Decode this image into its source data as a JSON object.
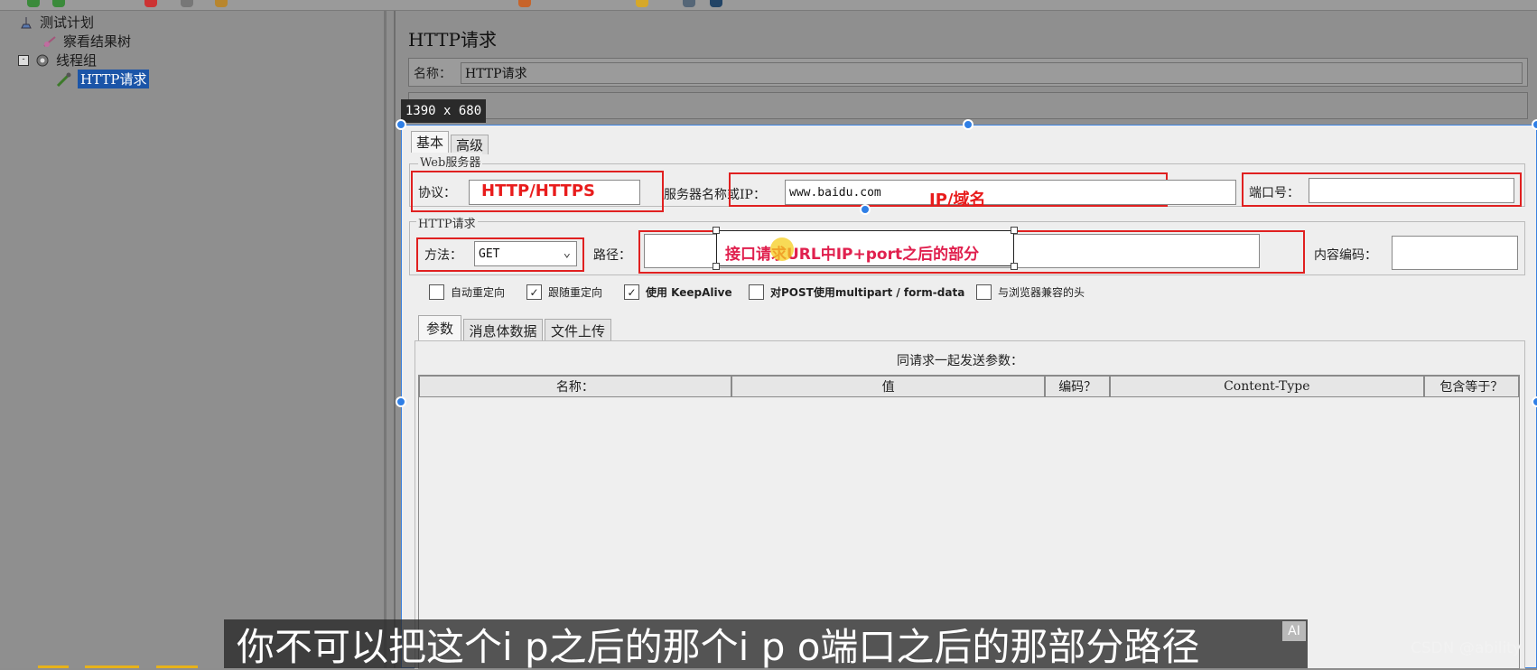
{
  "tree": {
    "items": [
      {
        "label": "测试计划",
        "icon": "test-plan-icon"
      },
      {
        "label": "察看结果树",
        "icon": "result-tree-icon"
      },
      {
        "label": "线程组",
        "icon": "gear-icon"
      },
      {
        "label": "HTTP请求",
        "icon": "pipette-icon"
      }
    ]
  },
  "panel": {
    "title": "HTTP请求",
    "name_label": "名称：",
    "name_value": "HTTP请求"
  },
  "capture": {
    "dimensions": "1390 x 680"
  },
  "tabs_top": [
    "基本",
    "高级"
  ],
  "web_server": {
    "group_label": "Web服务器",
    "protocol_label": "协议：",
    "protocol_annotation": "HTTP/HTTPS",
    "server_label": "服务器名称或IP：",
    "server_value": "www.baidu.com",
    "server_annotation": "IP/域名",
    "port_label": "端口号："
  },
  "http_request": {
    "group_label": "HTTP请求",
    "method_label": "方法：",
    "method_value": "GET",
    "path_label": "路径：",
    "path_annotation": "接口请求URL中IP+port之后的部分",
    "encoding_label": "内容编码："
  },
  "options": [
    {
      "label": "自动重定向",
      "checked": false
    },
    {
      "label": "跟随重定向",
      "checked": true
    },
    {
      "label": "使用 KeepAlive",
      "checked": true
    },
    {
      "label": "对POST使用multipart / form-data",
      "checked": false
    },
    {
      "label": "与浏览器兼容的头",
      "checked": false
    }
  ],
  "sub_tabs": [
    "参数",
    "消息体数据",
    "文件上传"
  ],
  "params": {
    "caption": "同请求一起发送参数：",
    "columns": [
      "名称：",
      "值",
      "编码？",
      "Content-Type",
      "包含等于？"
    ]
  },
  "subtitle": "你不可以把这个i p之后的那个i p o端口之后的那部分路径",
  "ai_badge": "AI",
  "watermark": "CSDN @ability",
  "colors": {
    "annotation": "#e02020",
    "selection": "#2f7fe6",
    "tree_selected": "#1b55a8"
  }
}
